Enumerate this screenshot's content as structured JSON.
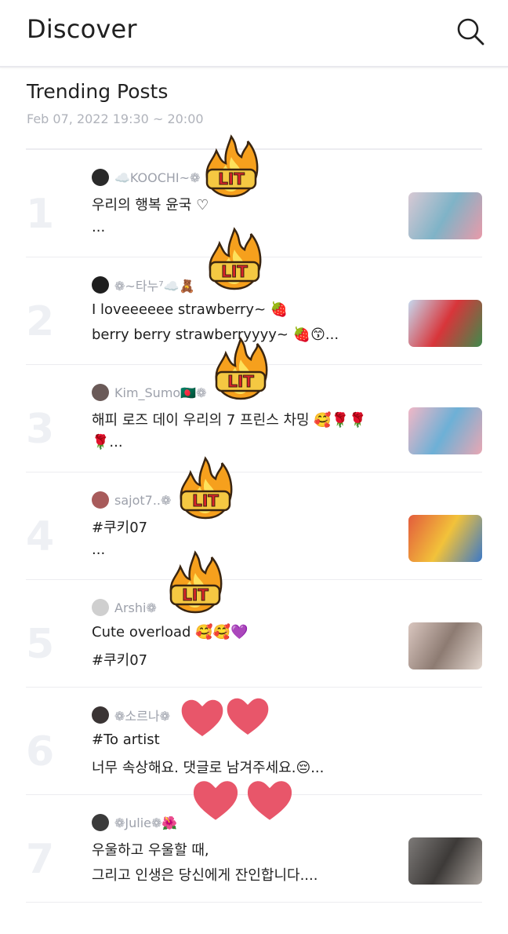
{
  "header": {
    "title": "Discover"
  },
  "section": {
    "title": "Trending Posts",
    "date": "Feb 07, 2022 19:30 ~ 20:00"
  },
  "stickers": {
    "lit_text": "LIT"
  },
  "posts": [
    {
      "rank": "1",
      "user": "☁️KOOCHI~❁",
      "line1": "우리의 행복 윤국 ♡",
      "line2": "...",
      "avatar_color": "#2a2a2a",
      "thumb_colors": [
        "#d8c9d4",
        "#7fb3c7",
        "#e99aa9"
      ]
    },
    {
      "rank": "2",
      "user": "❁~타누⁷☁️🧸",
      "line1": "I loveeeeee strawberry~ 🍓",
      "line2": "berry berry strawberryyyy~ 🍓😙...",
      "avatar_color": "#1f1f1f",
      "thumb_colors": [
        "#c6d8ee",
        "#d8353a",
        "#3f8b4c"
      ]
    },
    {
      "rank": "3",
      "user": "Kim_Sumo🇧🇩❁",
      "line1": "해피 로즈 데이 우리의 7 프린스 차밍 🥰🌹🌹",
      "line2": "🌹...",
      "avatar_color": "#6a5a58",
      "thumb_colors": [
        "#f1b7c6",
        "#6db0d6",
        "#e9a7b3"
      ]
    },
    {
      "rank": "4",
      "user": "sajot7..❁",
      "line1": "#쿠키07",
      "line2": "...",
      "avatar_color": "#a85b5b",
      "thumb_colors": [
        "#e35c3c",
        "#f2c23a",
        "#3c79c8"
      ]
    },
    {
      "rank": "5",
      "user": "Arshi❁",
      "line1": "Cute overload 🥰🥰💜",
      "line2": "#쿠키07",
      "avatar_color": "#cfcfcf",
      "thumb_colors": [
        "#d9c6bf",
        "#8d7b72",
        "#e4d8d0"
      ]
    },
    {
      "rank": "6",
      "user": "❁소르나❁",
      "line1": "#To artist",
      "line2": "너무 속상해요. 댓글로 남겨주세요.😔...",
      "avatar_color": "#3a3434",
      "thumb_colors": []
    },
    {
      "rank": "7",
      "user": "❁Julie❁🌺",
      "line1": "우울하고 우울할 때,",
      "line2": " 그리고 인생은 당신에게 잔인합니다....",
      "avatar_color": "#3b3b3b",
      "thumb_colors": [
        "#7d7a78",
        "#3d3a38",
        "#a9a29c"
      ]
    }
  ]
}
